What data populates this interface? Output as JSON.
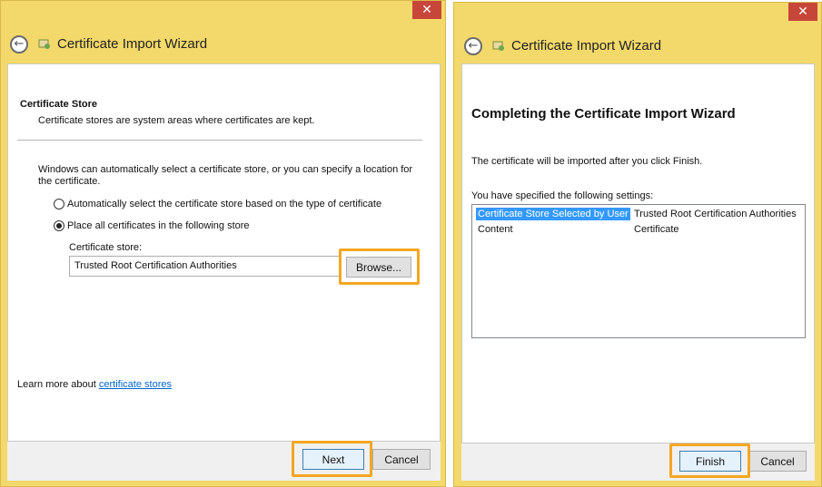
{
  "colors": {
    "frame": "#f3d96b",
    "close_button": "#c7463a",
    "highlight": "#f5a623",
    "selection": "#3399ff",
    "link": "#0066cc"
  },
  "left_window": {
    "close_glyph": "✕",
    "back_glyph": "←",
    "title": "Certificate Import Wizard",
    "section_heading": "Certificate Store",
    "section_description": "Certificate stores are system areas where certificates are kept.",
    "intro_line1": "Windows can automatically select a certificate store, or you can specify a location for",
    "intro_line2": "the certificate.",
    "radio_auto_label": "Automatically select the certificate store based on the type of certificate",
    "radio_place_label": "Place all certificates in the following store",
    "radio_selected": "place",
    "store_label": "Certificate store:",
    "store_value": "Trusted Root Certification Authorities",
    "browse_label": "Browse...",
    "learn_more_prefix": "Learn more about ",
    "learn_more_link": "certificate stores",
    "next_label": "Next",
    "cancel_label": "Cancel"
  },
  "right_window": {
    "close_glyph": "✕",
    "back_glyph": "←",
    "title": "Certificate Import Wizard",
    "heading": "Completing the Certificate Import Wizard",
    "import_note": "The certificate will be imported after you click Finish.",
    "settings_label": "You have specified the following settings:",
    "settings_rows": [
      {
        "key": "Certificate Store Selected by User",
        "value": "Trusted Root Certification Authorities",
        "selected": true
      },
      {
        "key": "Content",
        "value": "Certificate",
        "selected": false
      }
    ],
    "finish_label": "Finish",
    "cancel_label": "Cancel"
  }
}
